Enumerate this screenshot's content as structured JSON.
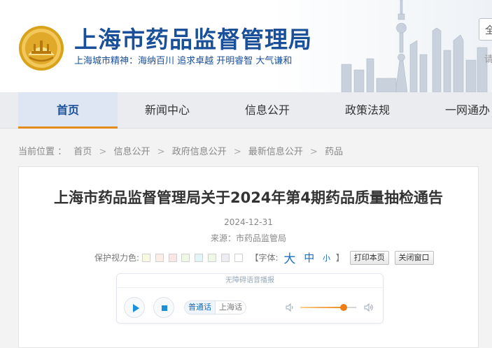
{
  "header": {
    "title": "上海市药品监督管理局",
    "slogan": "上海城市精神：海纳百川  追求卓越  开明睿智  大气谦和",
    "lang_label": "全",
    "search_label": "请"
  },
  "colors": {
    "brand": "#1a4f9a",
    "accent": "#e38b1d",
    "link": "#1a6fc0"
  },
  "nav": {
    "items": [
      {
        "label": "首页",
        "active": true
      },
      {
        "label": "新闻中心"
      },
      {
        "label": "信息公开"
      },
      {
        "label": "政策法规"
      },
      {
        "label": "一网通办"
      }
    ]
  },
  "breadcrumb": {
    "prefix": "当前位置 ：",
    "items": [
      "首页",
      "信息公开",
      "政府信息公开",
      "最新信息公开",
      "药品"
    ],
    "separator": ">"
  },
  "article": {
    "title": "上海市药品监督管理局关于2024年第4期药品质量抽检通告",
    "date": "2024-12-31",
    "source": "来源：市药品监管局"
  },
  "tools": {
    "eye_care_label": "保护视力色:",
    "eye_colors": [
      "#f9f8e0",
      "#fbeee6",
      "#fbe6e6",
      "#eef8e4",
      "#e1f5f7",
      "#eef8e4",
      "#ececf2",
      "#ffffff"
    ],
    "font_label": "【字体:",
    "font_large": "大",
    "font_medium": "中",
    "font_small": "小",
    "font_close": "】",
    "print_button": "打印本页",
    "close_button": "关闭窗口"
  },
  "player": {
    "title": "无障碍语音播报",
    "lang_mandarin": "普通话",
    "lang_shanghai": "上海话",
    "volume": 0.78,
    "icons": {
      "play": "play-icon",
      "stop": "stop-icon",
      "volume_low": "volume-low-icon",
      "volume_high": "volume-high-icon"
    }
  }
}
